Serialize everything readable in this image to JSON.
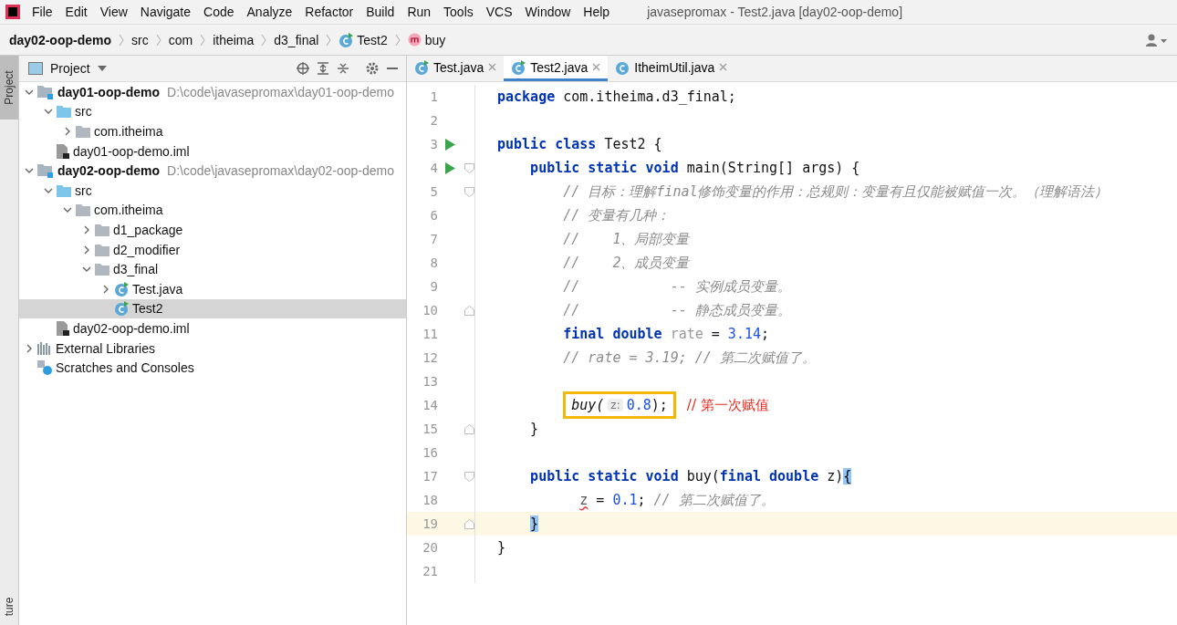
{
  "window": {
    "title": "javasepromax - Test2.java [day02-oop-demo]"
  },
  "menu": [
    "File",
    "Edit",
    "View",
    "Navigate",
    "Code",
    "Analyze",
    "Refactor",
    "Build",
    "Run",
    "Tools",
    "VCS",
    "Window",
    "Help"
  ],
  "breadcrumbs": [
    {
      "label": "day02-oop-demo",
      "kind": "module"
    },
    {
      "label": "src",
      "kind": "plain"
    },
    {
      "label": "com",
      "kind": "plain"
    },
    {
      "label": "itheima",
      "kind": "plain"
    },
    {
      "label": "d3_final",
      "kind": "plain"
    },
    {
      "label": "Test2",
      "kind": "class"
    },
    {
      "label": "buy",
      "kind": "method"
    }
  ],
  "side_strip": {
    "top": "Project",
    "bottom": "ture"
  },
  "project_panel": {
    "title": "Project"
  },
  "tree": [
    {
      "label": "day01-oop-demo",
      "kind": "module",
      "path": "D:\\code\\javasepromax\\day01-oop-demo",
      "expanded": true,
      "selected": false,
      "children": [
        {
          "label": "src",
          "kind": "src",
          "expanded": true,
          "selected": false,
          "children": [
            {
              "label": "com.itheima",
              "kind": "package",
              "expanded": false,
              "selected": false
            }
          ]
        },
        {
          "label": "day01-oop-demo.iml",
          "kind": "iml",
          "selected": false
        }
      ]
    },
    {
      "label": "day02-oop-demo",
      "kind": "module",
      "path": "D:\\code\\javasepromax\\day02-oop-demo",
      "expanded": true,
      "selected": false,
      "children": [
        {
          "label": "src",
          "kind": "src",
          "expanded": true,
          "selected": false,
          "children": [
            {
              "label": "com.itheima",
              "kind": "package",
              "expanded": true,
              "selected": false,
              "children": [
                {
                  "label": "d1_package",
                  "kind": "package",
                  "expanded": false,
                  "selected": false
                },
                {
                  "label": "d2_modifier",
                  "kind": "package",
                  "expanded": false,
                  "selected": false
                },
                {
                  "label": "d3_final",
                  "kind": "package",
                  "expanded": true,
                  "selected": false,
                  "children": [
                    {
                      "label": "Test.java",
                      "kind": "class",
                      "expanded": false,
                      "selected": false
                    },
                    {
                      "label": "Test2",
                      "kind": "class",
                      "selected": true
                    }
                  ]
                }
              ]
            }
          ]
        },
        {
          "label": "day02-oop-demo.iml",
          "kind": "iml",
          "selected": false
        }
      ]
    },
    {
      "label": "External Libraries",
      "kind": "libraries",
      "expanded": false,
      "selected": false
    },
    {
      "label": "Scratches and Consoles",
      "kind": "scratches",
      "selected": false
    }
  ],
  "tabs": [
    {
      "label": "Test.java",
      "selected": false,
      "runnable": true
    },
    {
      "label": "Test2.java",
      "selected": true,
      "runnable": true
    },
    {
      "label": "ItheimUtil.java",
      "selected": false,
      "runnable": false
    }
  ],
  "code": [
    {
      "number": "1",
      "kind": "top",
      "current": false,
      "tokens": [
        {
          "kind": "kw",
          "text": "package"
        },
        {
          "kind": "plain",
          "text": " com.itheima.d3_final;"
        }
      ]
    },
    {
      "number": "2",
      "kind": "blank",
      "current": false
    },
    {
      "number": "3",
      "kind": "top",
      "current": false,
      "runnable": true,
      "tokens": [
        {
          "kind": "kw",
          "text": "public class"
        },
        {
          "kind": "plain",
          "text": " Test2 {"
        }
      ]
    },
    {
      "number": "4",
      "kind": "member",
      "current": false,
      "runnable": true,
      "fold": true,
      "tokens": [
        {
          "kind": "kw",
          "text": "public static void"
        },
        {
          "kind": "plain",
          "text": " main(String[] args) {"
        }
      ]
    },
    {
      "number": "5",
      "kind": "body",
      "current": false,
      "fold": true,
      "tokens": [
        {
          "kind": "comment",
          "text": "// 目标：理解final修饰变量的作用：总规则：变量有且仅能被赋值一次。（理解语法）"
        }
      ]
    },
    {
      "number": "6",
      "kind": "body",
      "current": false,
      "tokens": [
        {
          "kind": "comment",
          "text": "// 变量有几种："
        }
      ]
    },
    {
      "number": "7",
      "kind": "body",
      "current": false,
      "tokens": [
        {
          "kind": "comment",
          "text": "//    1、局部变量"
        }
      ]
    },
    {
      "number": "8",
      "kind": "body",
      "current": false,
      "tokens": [
        {
          "kind": "comment",
          "text": "//    2、成员变量"
        }
      ]
    },
    {
      "number": "9",
      "kind": "body",
      "current": false,
      "tokens": [
        {
          "kind": "comment",
          "text": "//           -- 实例成员变量。"
        }
      ]
    },
    {
      "number": "10",
      "kind": "body",
      "current": false,
      "fold_end": true,
      "tokens": [
        {
          "kind": "comment",
          "text": "//           -- 静态成员变量。"
        }
      ]
    },
    {
      "number": "11",
      "kind": "body",
      "current": false,
      "tokens": [
        {
          "kind": "kw",
          "text": "final double"
        },
        {
          "kind": "unused",
          "text": " rate"
        },
        {
          "kind": "plain",
          "text": " = "
        },
        {
          "kind": "num",
          "text": "3.14"
        },
        {
          "kind": "plain",
          "text": ";"
        }
      ]
    },
    {
      "number": "12",
      "kind": "body",
      "current": false,
      "tokens": [
        {
          "kind": "comment",
          "text": "// rate = 3.19; // 第二次赋值了。"
        }
      ]
    },
    {
      "number": "13",
      "kind": "blank",
      "current": false
    },
    {
      "number": "14",
      "kind": "body",
      "current": false,
      "tokens": [
        {
          "kind": "boxed",
          "tokens": [
            {
              "kind": "call",
              "text": "buy("
            },
            {
              "kind": "hint",
              "text": "z:"
            },
            {
              "kind": "num",
              "text": "0.8"
            },
            {
              "kind": "plain",
              "text": ");"
            }
          ]
        },
        {
          "kind": "note",
          "text": "// 第一次赋值"
        }
      ]
    },
    {
      "number": "15",
      "kind": "member",
      "current": false,
      "fold_end": true,
      "tokens": [
        {
          "kind": "plain",
          "text": "}"
        }
      ]
    },
    {
      "number": "16",
      "kind": "blank",
      "current": false
    },
    {
      "number": "17",
      "kind": "member",
      "current": false,
      "fold": true,
      "tokens": [
        {
          "kind": "kw",
          "text": "public static void"
        },
        {
          "kind": "plain",
          "text": " buy("
        },
        {
          "kind": "kw",
          "text": "final double"
        },
        {
          "kind": "plain",
          "text": " z)"
        },
        {
          "kind": "match",
          "text": "{"
        }
      ]
    },
    {
      "number": "18",
      "kind": "deep",
      "current": false,
      "tokens": [
        {
          "kind": "error",
          "text": "z"
        },
        {
          "kind": "plain",
          "text": " = "
        },
        {
          "kind": "num",
          "text": "0.1"
        },
        {
          "kind": "plain",
          "text": "; "
        },
        {
          "kind": "comment",
          "text": "// 第二次赋值了。"
        }
      ]
    },
    {
      "number": "19",
      "kind": "member",
      "current": true,
      "fold_end": true,
      "tokens": [
        {
          "kind": "match",
          "text": "}"
        }
      ]
    },
    {
      "number": "20",
      "kind": "top",
      "current": false,
      "tokens": [
        {
          "kind": "plain",
          "text": "}"
        }
      ]
    },
    {
      "number": "21",
      "kind": "blank",
      "current": false
    }
  ]
}
